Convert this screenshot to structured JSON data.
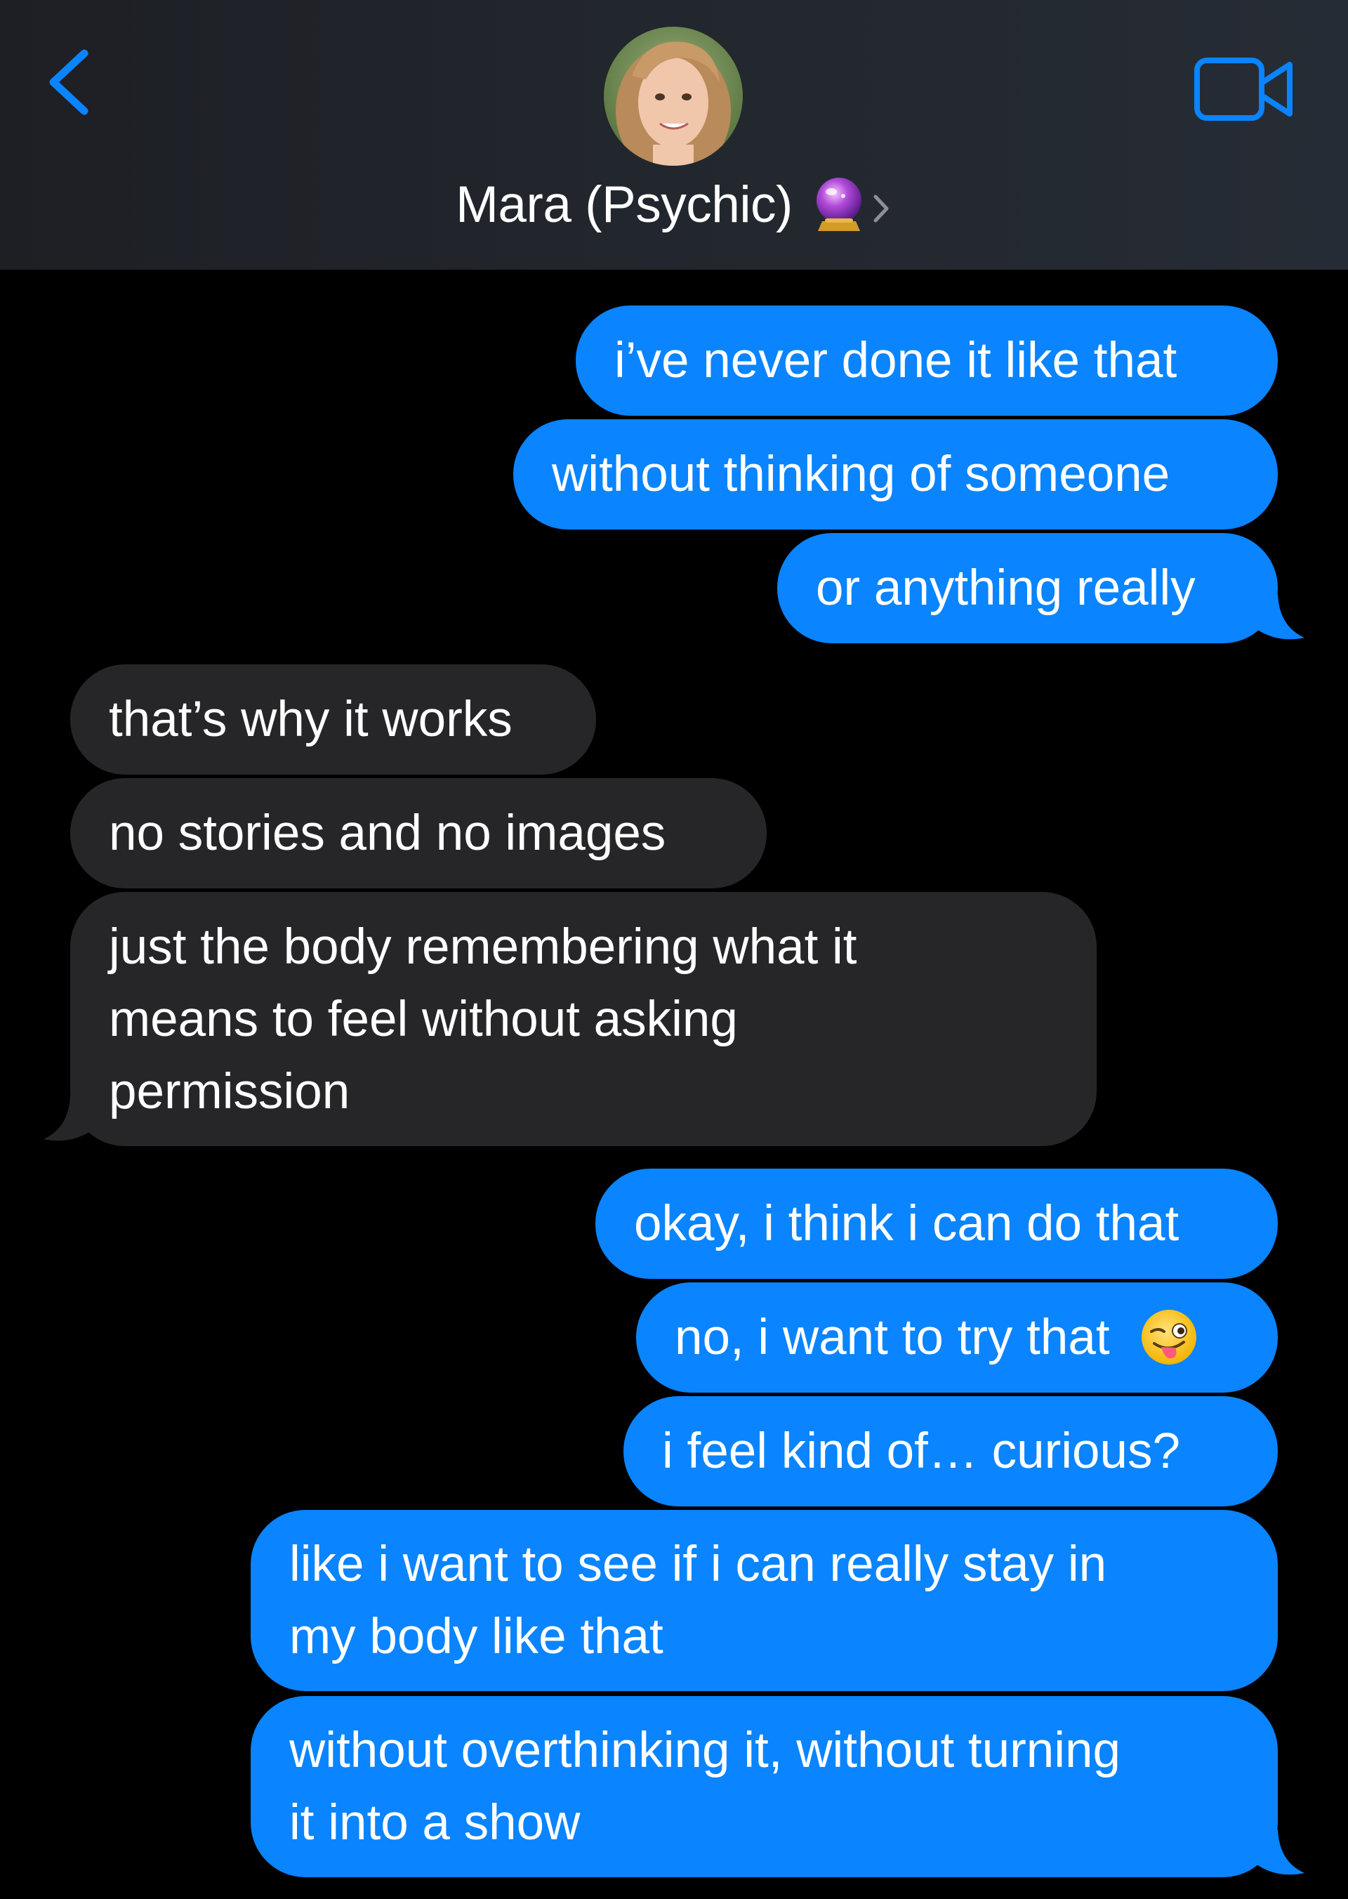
{
  "header": {
    "contact_name": "Mara (Psychic)",
    "contact_emoji": "crystal-ball-icon",
    "back_icon": "chevron-left-icon",
    "video_icon": "video-camera-icon",
    "accent_color": "#0a84ff"
  },
  "messages": [
    {
      "side": "sent",
      "lines": [
        "i’ve never done it like that"
      ]
    },
    {
      "side": "sent",
      "lines": [
        "without thinking of someone"
      ]
    },
    {
      "side": "sent",
      "lines": [
        "or anything really"
      ]
    },
    {
      "side": "received",
      "lines": [
        "that’s why it works"
      ]
    },
    {
      "side": "received",
      "lines": [
        "no stories and no images"
      ]
    },
    {
      "side": "received",
      "lines": [
        "just the body remembering what it",
        "means to feel without asking",
        "permission"
      ]
    },
    {
      "side": "sent",
      "lines": [
        "okay, i think i can do that"
      ]
    },
    {
      "side": "sent",
      "lines": [
        "no, i want to try that"
      ],
      "emoji": "winking-face-with-tongue-icon"
    },
    {
      "side": "sent",
      "lines": [
        "i feel kind of… curious?"
      ]
    },
    {
      "side": "sent",
      "lines": [
        "like i want to see if i can really stay in",
        "my body like that"
      ]
    },
    {
      "side": "sent",
      "lines": [
        "without overthinking it, without turning",
        "it into a show"
      ]
    }
  ],
  "colors": {
    "sent_bubble": "#0a84ff",
    "received_bubble": "#262628",
    "background": "#000000",
    "text": "#ffffff"
  }
}
